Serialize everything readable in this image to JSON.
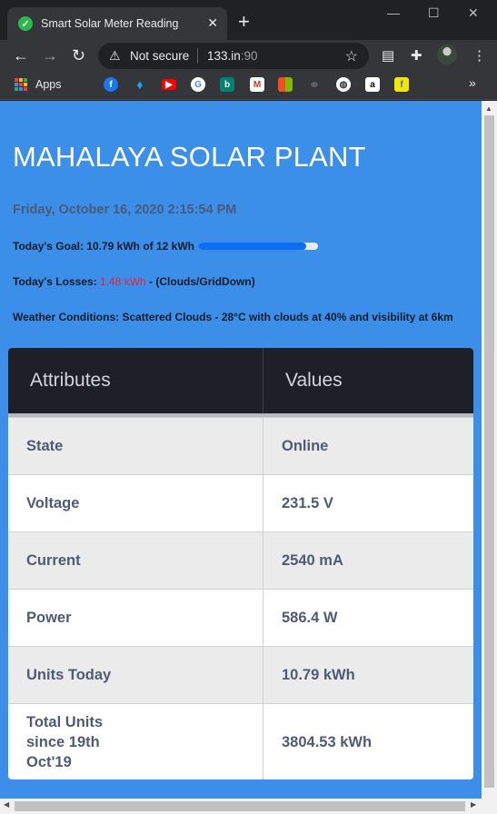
{
  "browser": {
    "tab_title": "Smart Solar Meter Reading",
    "security_label": "Not secure",
    "url_host": "133.in",
    "url_port": ":90",
    "apps_label": "Apps"
  },
  "page": {
    "title": "MAHALAYA SOLAR PLANT",
    "datetime": "Friday, October 16, 2020 2:15:54 PM",
    "goal_text": "Today's Goal: 10.79 kWh of 12 kWh",
    "goal_progress": 0.9,
    "losses_prefix": "Today's Losses: ",
    "losses_value": "1.48 kWh",
    "losses_suffix": " - (Clouds/GridDown)",
    "weather": "Weather Conditions: Scattered Clouds - 28°C with clouds at 40% and visibility at 6km"
  },
  "table": {
    "headers": [
      "Attributes",
      "Values"
    ],
    "rows": [
      {
        "attr": "State",
        "value": "Online"
      },
      {
        "attr": "Voltage",
        "value": "231.5 V"
      },
      {
        "attr": "Current",
        "value": "2540 mA"
      },
      {
        "attr": "Power",
        "value": "586.4 W"
      },
      {
        "attr": "Units Today",
        "value": "10.79 kWh"
      },
      {
        "attr": "Total Units since 19th Oct'19",
        "value": "3804.53 kWh"
      }
    ]
  },
  "colors": {
    "page_bg": "#3c8fe8",
    "loss_red": "#e8213c",
    "progress_blue": "#0b6ef5",
    "table_header_bg": "#1d2027"
  }
}
